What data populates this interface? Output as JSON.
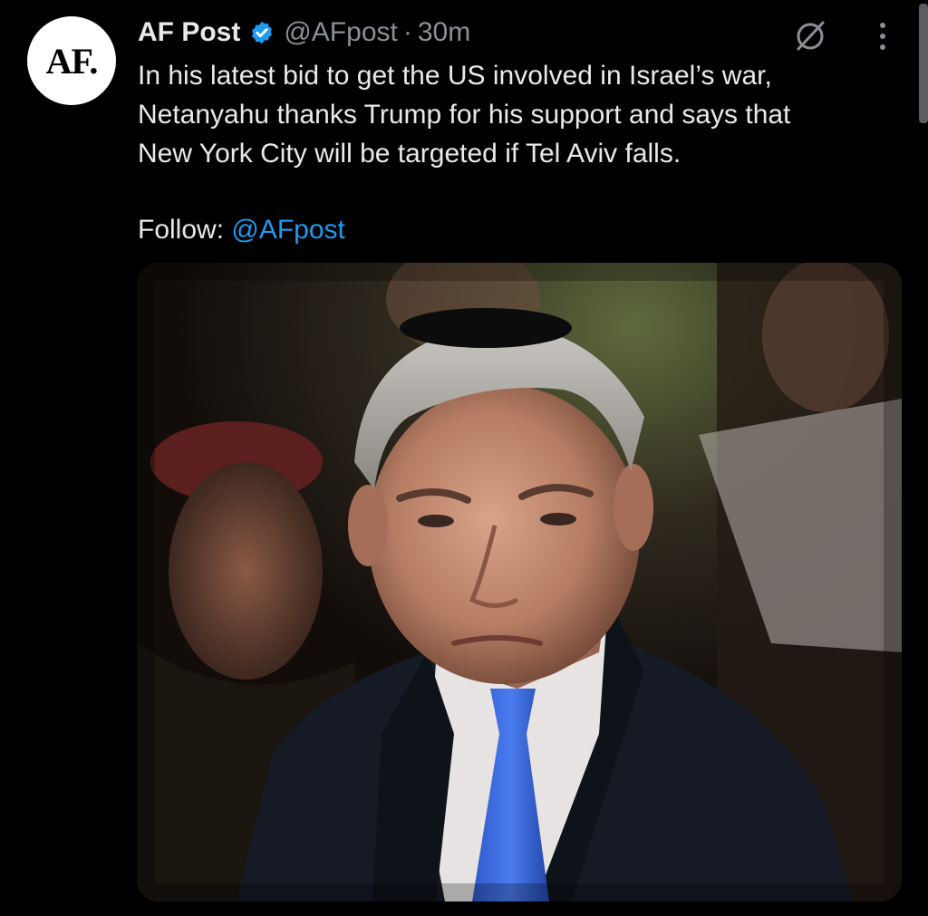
{
  "tweet": {
    "author_name": "AF Post",
    "handle": "@AFpost",
    "separator": "·",
    "time": "30m",
    "avatar_text": "AF.",
    "text_lines": [
      "In his latest bid to get the US involved in Israel’s war,",
      "Netanyahu thanks Trump for his support and says that",
      "New York City will be targeted if Tel Aviv falls."
    ],
    "follow_label": "Follow:",
    "follow_link": "@AFpost"
  },
  "icons": {
    "verified": "verified-badge-icon",
    "grok": "grok-icon",
    "more": "more-vertical-icon"
  },
  "colors": {
    "background": "#000000",
    "text": "#e7e9ea",
    "muted": "#8b9096",
    "link": "#1d9bf0",
    "verified": "#1d9bf0"
  }
}
